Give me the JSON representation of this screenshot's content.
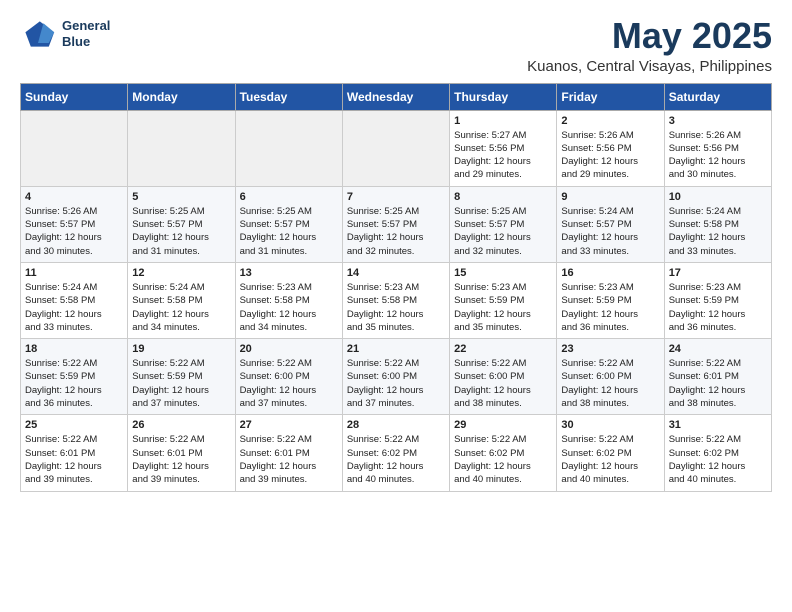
{
  "logo": {
    "line1": "General",
    "line2": "Blue"
  },
  "title": "May 2025",
  "subtitle": "Kuanos, Central Visayas, Philippines",
  "days_of_week": [
    "Sunday",
    "Monday",
    "Tuesday",
    "Wednesday",
    "Thursday",
    "Friday",
    "Saturday"
  ],
  "weeks": [
    [
      {
        "day": "",
        "info": ""
      },
      {
        "day": "",
        "info": ""
      },
      {
        "day": "",
        "info": ""
      },
      {
        "day": "",
        "info": ""
      },
      {
        "day": "1",
        "info": "Sunrise: 5:27 AM\nSunset: 5:56 PM\nDaylight: 12 hours\nand 29 minutes."
      },
      {
        "day": "2",
        "info": "Sunrise: 5:26 AM\nSunset: 5:56 PM\nDaylight: 12 hours\nand 29 minutes."
      },
      {
        "day": "3",
        "info": "Sunrise: 5:26 AM\nSunset: 5:56 PM\nDaylight: 12 hours\nand 30 minutes."
      }
    ],
    [
      {
        "day": "4",
        "info": "Sunrise: 5:26 AM\nSunset: 5:57 PM\nDaylight: 12 hours\nand 30 minutes."
      },
      {
        "day": "5",
        "info": "Sunrise: 5:25 AM\nSunset: 5:57 PM\nDaylight: 12 hours\nand 31 minutes."
      },
      {
        "day": "6",
        "info": "Sunrise: 5:25 AM\nSunset: 5:57 PM\nDaylight: 12 hours\nand 31 minutes."
      },
      {
        "day": "7",
        "info": "Sunrise: 5:25 AM\nSunset: 5:57 PM\nDaylight: 12 hours\nand 32 minutes."
      },
      {
        "day": "8",
        "info": "Sunrise: 5:25 AM\nSunset: 5:57 PM\nDaylight: 12 hours\nand 32 minutes."
      },
      {
        "day": "9",
        "info": "Sunrise: 5:24 AM\nSunset: 5:57 PM\nDaylight: 12 hours\nand 33 minutes."
      },
      {
        "day": "10",
        "info": "Sunrise: 5:24 AM\nSunset: 5:58 PM\nDaylight: 12 hours\nand 33 minutes."
      }
    ],
    [
      {
        "day": "11",
        "info": "Sunrise: 5:24 AM\nSunset: 5:58 PM\nDaylight: 12 hours\nand 33 minutes."
      },
      {
        "day": "12",
        "info": "Sunrise: 5:24 AM\nSunset: 5:58 PM\nDaylight: 12 hours\nand 34 minutes."
      },
      {
        "day": "13",
        "info": "Sunrise: 5:23 AM\nSunset: 5:58 PM\nDaylight: 12 hours\nand 34 minutes."
      },
      {
        "day": "14",
        "info": "Sunrise: 5:23 AM\nSunset: 5:58 PM\nDaylight: 12 hours\nand 35 minutes."
      },
      {
        "day": "15",
        "info": "Sunrise: 5:23 AM\nSunset: 5:59 PM\nDaylight: 12 hours\nand 35 minutes."
      },
      {
        "day": "16",
        "info": "Sunrise: 5:23 AM\nSunset: 5:59 PM\nDaylight: 12 hours\nand 36 minutes."
      },
      {
        "day": "17",
        "info": "Sunrise: 5:23 AM\nSunset: 5:59 PM\nDaylight: 12 hours\nand 36 minutes."
      }
    ],
    [
      {
        "day": "18",
        "info": "Sunrise: 5:22 AM\nSunset: 5:59 PM\nDaylight: 12 hours\nand 36 minutes."
      },
      {
        "day": "19",
        "info": "Sunrise: 5:22 AM\nSunset: 5:59 PM\nDaylight: 12 hours\nand 37 minutes."
      },
      {
        "day": "20",
        "info": "Sunrise: 5:22 AM\nSunset: 6:00 PM\nDaylight: 12 hours\nand 37 minutes."
      },
      {
        "day": "21",
        "info": "Sunrise: 5:22 AM\nSunset: 6:00 PM\nDaylight: 12 hours\nand 37 minutes."
      },
      {
        "day": "22",
        "info": "Sunrise: 5:22 AM\nSunset: 6:00 PM\nDaylight: 12 hours\nand 38 minutes."
      },
      {
        "day": "23",
        "info": "Sunrise: 5:22 AM\nSunset: 6:00 PM\nDaylight: 12 hours\nand 38 minutes."
      },
      {
        "day": "24",
        "info": "Sunrise: 5:22 AM\nSunset: 6:01 PM\nDaylight: 12 hours\nand 38 minutes."
      }
    ],
    [
      {
        "day": "25",
        "info": "Sunrise: 5:22 AM\nSunset: 6:01 PM\nDaylight: 12 hours\nand 39 minutes."
      },
      {
        "day": "26",
        "info": "Sunrise: 5:22 AM\nSunset: 6:01 PM\nDaylight: 12 hours\nand 39 minutes."
      },
      {
        "day": "27",
        "info": "Sunrise: 5:22 AM\nSunset: 6:01 PM\nDaylight: 12 hours\nand 39 minutes."
      },
      {
        "day": "28",
        "info": "Sunrise: 5:22 AM\nSunset: 6:02 PM\nDaylight: 12 hours\nand 40 minutes."
      },
      {
        "day": "29",
        "info": "Sunrise: 5:22 AM\nSunset: 6:02 PM\nDaylight: 12 hours\nand 40 minutes."
      },
      {
        "day": "30",
        "info": "Sunrise: 5:22 AM\nSunset: 6:02 PM\nDaylight: 12 hours\nand 40 minutes."
      },
      {
        "day": "31",
        "info": "Sunrise: 5:22 AM\nSunset: 6:02 PM\nDaylight: 12 hours\nand 40 minutes."
      }
    ]
  ]
}
